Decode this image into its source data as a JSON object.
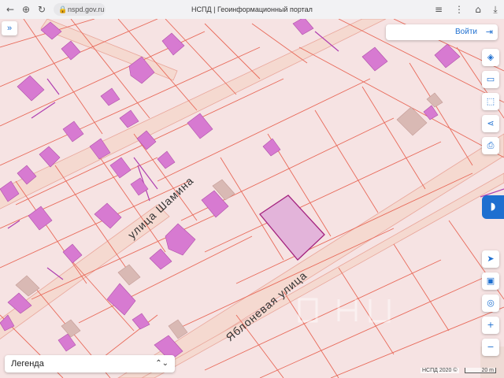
{
  "browser": {
    "url": "nspd.gov.ru",
    "tab_title": "НСПД | Геоинформационный портал"
  },
  "header": {
    "login_label": "Войти"
  },
  "map": {
    "street_labels": [
      "улица Шамина",
      "Яблоневая улица"
    ],
    "colors": {
      "land": "#f6e3e3",
      "parcel_line": "#e86a5a",
      "building": "#d77ad1",
      "road": "#f5d9d0",
      "selected_fill": "#e3b4da",
      "selected_stroke": "#a4237f"
    }
  },
  "tools": [
    "layers-icon",
    "ruler-icon",
    "select-area-icon",
    "share-icon",
    "print-icon",
    "locate-icon",
    "minimap-icon",
    "gps-icon",
    "zoom-in-icon",
    "zoom-out-icon"
  ],
  "legend": {
    "label": "Легенда"
  },
  "footer": {
    "credit": "НСПД 2020 ©",
    "scale": "20 m"
  }
}
